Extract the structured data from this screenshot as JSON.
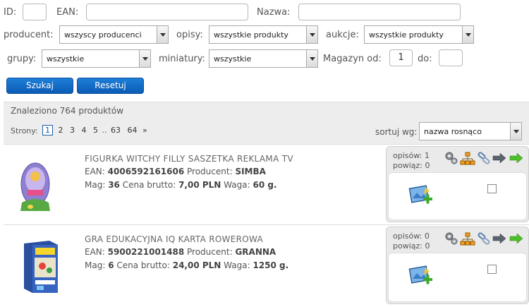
{
  "filters": {
    "id_label": "ID:",
    "ean_label": "EAN:",
    "name_label": "Nazwa:",
    "producer_label": "producent:",
    "producer_value": "wszyscy producenci",
    "descriptions_label": "opisy:",
    "descriptions_value": "wszystkie produkty",
    "auctions_label": "aukcje:",
    "auctions_value": "wszystkie produkty",
    "groups_label": "grupy:",
    "groups_value": "wszystkie",
    "thumbnails_label": "miniatury:",
    "thumbnails_value": "wszystkie",
    "stock_from_label": "Magazyn od:",
    "stock_from_value": "1",
    "stock_to_label": "do:",
    "search_button": "Szukaj",
    "reset_button": "Resetuj"
  },
  "results": {
    "found_text": "Znaleziono 764 produktów",
    "pages_label": "Strony:",
    "pages": [
      "1",
      "2",
      "3",
      "4",
      "5",
      "..",
      "63",
      "64",
      "»"
    ],
    "current_page": "1",
    "sort_label": "sortuj wg:",
    "sort_value": "nazwa rosnąco"
  },
  "products": [
    {
      "title": "FIGURKA WITCHY FILLY SASZETKA REKLAMA TV",
      "ean_label": "EAN:",
      "ean": "4006592161606",
      "producer_label": "Producent:",
      "producer": "SIMBA",
      "stock_label": "Mag:",
      "stock": "36",
      "price_label": "Cena brutto:",
      "price": "7,00 PLN",
      "weight_label": "Waga:",
      "weight": "60 g.",
      "descriptions_label": "opisów:",
      "descriptions_count": "1",
      "links_label": "powiąz:",
      "links_count": "0"
    },
    {
      "title": "GRA EDUKACYJNA IQ KARTA ROWEROWA",
      "ean_label": "EAN:",
      "ean": "5900221001488",
      "producer_label": "Producent:",
      "producer": "GRANNA",
      "stock_label": "Mag:",
      "stock": "6",
      "price_label": "Cena brutto:",
      "price": "24,00 PLN",
      "weight_label": "Waga:",
      "weight": "1250 g.",
      "descriptions_label": "opisów:",
      "descriptions_count": "0",
      "links_label": "powiąz:",
      "links_count": "0"
    }
  ],
  "colors": {
    "button_blue": "#0b5bb5",
    "producer_text": "#444444",
    "results_bar": "#ededed"
  }
}
